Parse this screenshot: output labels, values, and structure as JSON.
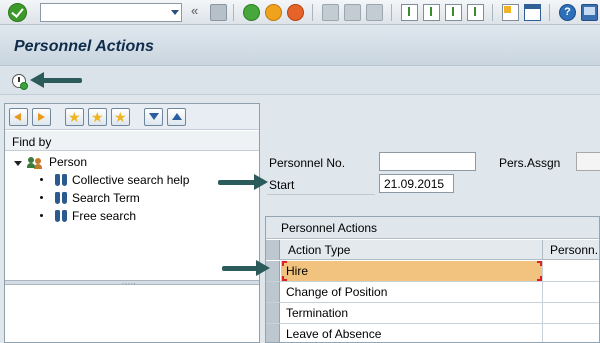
{
  "toolbar": {
    "command_field_value": "",
    "double_arrow": "«",
    "help_glyph": "?",
    "icons": [
      "enter-icon",
      "save-icon",
      "back-icon",
      "exit-icon",
      "cancel-icon",
      "print-icon",
      "find-icon",
      "find-next-icon",
      "first-page-icon",
      "previous-page-icon",
      "next-page-icon",
      "last-page-icon",
      "create-session-icon",
      "shortcut-icon",
      "help-icon",
      "customize-layout-icon"
    ]
  },
  "screen": {
    "title": "Personnel Actions"
  },
  "app_toolbar": {
    "icons": [
      "execute-icon"
    ]
  },
  "navigation": {
    "toolbar_icons": [
      "previous-object-icon",
      "next-object-icon",
      "add-favorite-icon",
      "favorites-icon",
      "favorite-settings-icon",
      "expand-navigation-icon",
      "collapse-navigation-icon"
    ],
    "find_by_label": "Find by",
    "tree": {
      "root_label": "Person",
      "children": [
        "Collective search help",
        "Search Term",
        "Free search"
      ]
    },
    "splitter_grip": "....."
  },
  "form": {
    "personnel_no_label": "Personnel No.",
    "personnel_no_value": "",
    "pers_assgn_label": "Pers.Assgn",
    "pers_assgn_value": "",
    "start_label": "Start",
    "start_value": "21.09.2015"
  },
  "actions_table": {
    "title": "Personnel Actions",
    "columns": [
      "Action Type",
      "Personn..."
    ],
    "rows": [
      {
        "action_type": "Hire",
        "selected": true
      },
      {
        "action_type": "Change of Position",
        "selected": false
      },
      {
        "action_type": "Termination",
        "selected": false
      },
      {
        "action_type": "Leave of Absence",
        "selected": false
      }
    ]
  },
  "colors": {
    "selected_row": "#f1c37e",
    "annotation_arrow": "#2b5b5a",
    "title_text": "#102c4a"
  }
}
